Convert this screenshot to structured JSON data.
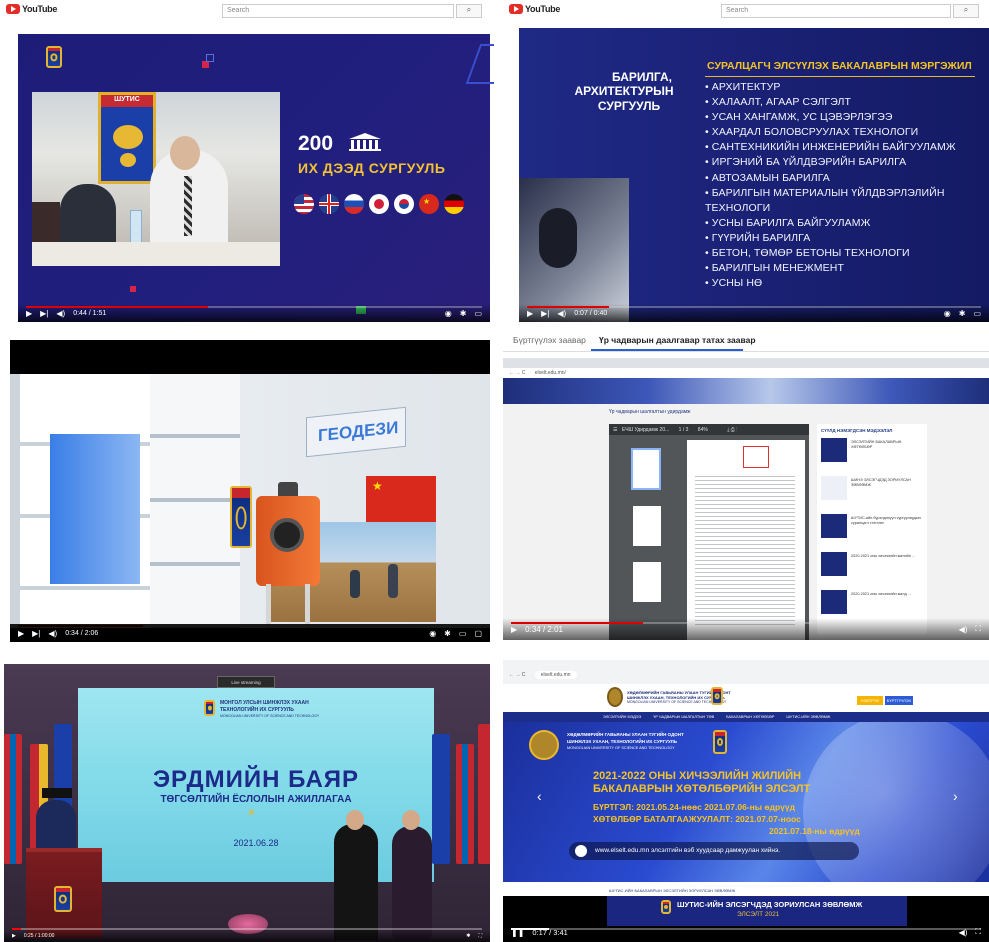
{
  "panels": {
    "p1": {
      "yt_logo": "YouTube",
      "search_placeholder": "Search",
      "headline_number": "200",
      "headline_text": "ИХ ДЭЭД СУРГУУЛЬ",
      "emblem_text": "ШУТИС",
      "time": "0:44 / 1:51",
      "progress": 0.4
    },
    "p2": {
      "yt_logo": "YouTube",
      "search_placeholder": "Search",
      "school_title": [
        "БАРИЛГА,",
        "АРХИТЕКТУРЫН",
        "СУРГУУЛЬ"
      ],
      "list_title": "СУРАЛЦАГЧ ЭЛСҮҮЛЭХ БАКАЛАВРЫН МЭРГЭЖИЛ",
      "majors": [
        "• АРХИТЕКТУР",
        "• ХАЛААЛТ, АГААР СЭЛГЭЛТ",
        "• УСАН ХАНГАМЖ, УС ЦЭВЭРЛЭГЭЭ",
        "• ХААРДАЛ БОЛОВСРУУЛАХ ТЕХНОЛОГИ",
        "• САНТЕХНИКИЙН ИНЖЕНЕРИЙН БАЙГУУЛАМЖ",
        "• ИРГЭНИЙ БА ҮЙЛДВЭРИЙН БАРИЛГА",
        "• АВТОЗАМЫН БАРИЛГА",
        "• БАРИЛГЫН МАТЕРИАЛЫН ҮЙЛДВЭРЛЭЛИЙН ТЕХНОЛОГИ",
        "• УСНЫ БАРИЛГА БАЙГУУЛАМЖ",
        "• ГҮҮРИЙН БАРИЛГА",
        "• БЕТОН, ТӨМӨР БЕТОНЫ ТЕХНОЛОГИ",
        "• БАРИЛГЫН МЕНЕЖМЕНТ",
        "• УСНЫ НӨ"
      ],
      "time": "0:07 / 0:40",
      "progress": 0.18
    },
    "p3": {
      "sign_text": "ГЕОДЕЗИ",
      "time": "0:34 / 2:06",
      "progress": 0.27
    },
    "p4": {
      "tabs": [
        "Бүртгүүлэх заавар",
        "Үр чадварын даалгавар татах заавар"
      ],
      "active_tab": 1,
      "browser_url": "elselt.edu.mn/",
      "doc_heading": "Үр чадварын шалгалтын удирдамж",
      "pdf_title": "ЕЧШ Удирдамж 20...",
      "pdf_page": "1 / 3",
      "pdf_zoom": "84%",
      "side_title": "СҮҮЛД НЭМЭГДСЭН МЭДЭЭЛЭЛ",
      "side_items": [
        "ЭЛСЭЛТИЙН БАКАЛАВРЫН ХӨТӨЛБӨР",
        "ШИНЭ ЭЛСЭГЧДЭД ЗОРИУЛСАН ЗӨВЛӨМЖ",
        "ШУТИС-ийн бүрэлдэхүүн сургуулиудын суралцагч тэтгэлэг",
        "2020-2021 оны хичээлийн жилийн ...",
        "2020-2021 оны хичээлийн жилд ..."
      ],
      "time": "0:34 / 2:01",
      "progress": 0.28
    },
    "p5": {
      "top_label": "Live streaming",
      "univ_name_1": "МОНГОЛ УЛСЫН ШИНЖЛЭХ УХААН",
      "univ_name_2": "ТЕХНОЛОГИЙН ИХ СУРГУУЛЬ",
      "univ_name_en": "MONGOLIAN UNIVERSITY OF SCIENCE AND TECHNOLOGY",
      "title": "ЭРДМИЙН БАЯР",
      "subtitle": "ТӨГСӨЛТИЙН ЁСЛОЛЫН АЖИЛЛАГАА",
      "date": "2021.06.28",
      "time": "0:25 / 1:00:00",
      "progress": 0.02
    },
    "p6": {
      "browser_url": "elselt.edu.mn",
      "site_name_1": "ХӨДӨЛМӨРИЙН ГАВЬЯАНЫ УЛААН ТУГИЙН ОДОНТ",
      "site_name_2": "ШИНЖЛЭХ УХААН, ТЕХНОЛОГИЙН ИХ СУРГУУЛЬ",
      "site_name_en": "MONGOLIAN UNIVERSITY OF SCIENCE AND TECHNOLOGY",
      "nav_items": [
        "ЭЛСЭЛТИЙН МЭДЭЭ",
        "ҮР ЧАДВАРЫН ШАЛГАЛТЫН ТӨВ",
        "БАКАЛАВРЫН ХӨТӨЛБӨР",
        "ШУТИС-ИЙН ЗӨВЛӨМЖ"
      ],
      "login_btn": "НЭВТРЭХ",
      "register_btn": "БҮРТГҮҮЛЭХ",
      "banner_title_1": "2021-2022 ОНЫ ХИЧЭЭЛИЙН ЖИЛИЙН",
      "banner_title_2": "БАКАЛАВРЫН ХӨТӨЛБӨРИЙН ЭЛСЭЛТ",
      "register_line": "БҮРТГЭЛ: 2021.05.24-нөөс 2021.07.06-ны өдрүүд",
      "confirm_line_1": "ХӨТӨЛБӨР БАТАЛГААЖУУЛАЛТ: 2021.07.07-ноос",
      "confirm_line_2": "2021.07.18-ны өдрүүд",
      "web_note": "www.elselt.edu.mn  элсэлтийн вэб хуудсаар дамжуулан хийнэ.",
      "section_link": "ШУТИС-ИЙН БАКАЛАВРЫН ЭЛСЭЛТИЙН ЗОРИУЛСАН ЗӨВЛӨМЖ",
      "advice_title": "ШУТИС-ИЙН ЭЛСЭГЧДЭД ЗОРИУЛСАН ЗӨВЛӨМЖ",
      "advice_sub": "ЭЛСЭЛТ 2021",
      "time": "0:17 / 3:41",
      "progress": 0.08
    }
  },
  "colors": {
    "navy": "#1b1f6e",
    "gold": "#f4c326",
    "yt_red": "#e52d27",
    "cyan_stage": "#7fd9e8"
  }
}
